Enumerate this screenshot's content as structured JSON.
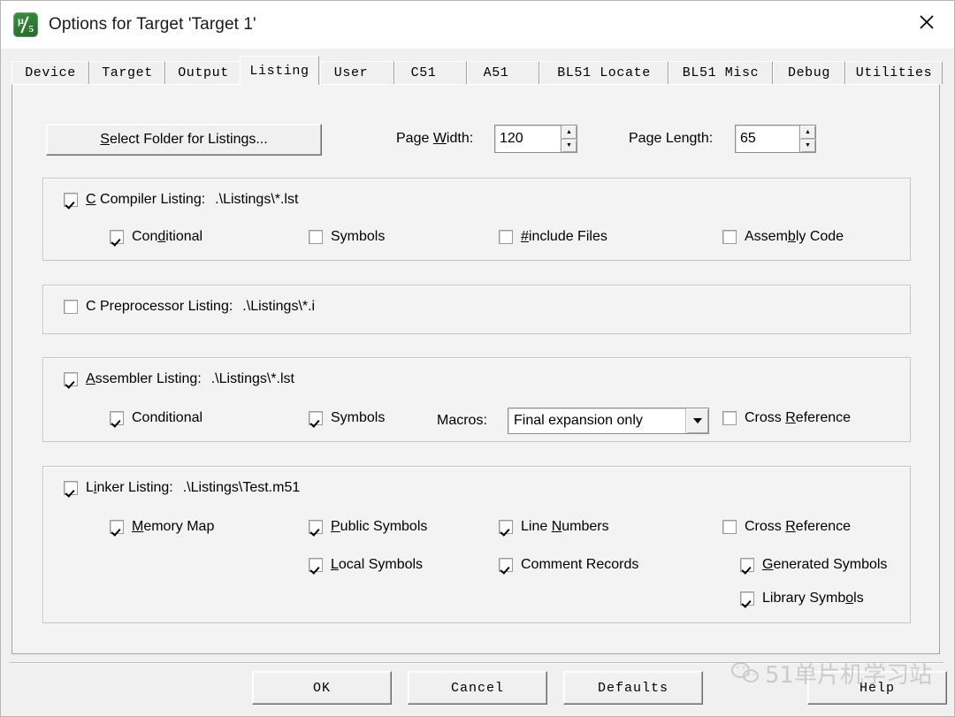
{
  "window": {
    "title": "Options for Target 'Target 1'",
    "app_icon": "keil-uvision5-icon",
    "close_label": "✕"
  },
  "tabs": [
    {
      "label": "Device",
      "selected": false
    },
    {
      "label": "Target",
      "selected": false
    },
    {
      "label": "Output",
      "selected": false
    },
    {
      "label": "Listing",
      "selected": true
    },
    {
      "label": "User",
      "selected": false
    },
    {
      "label": "C51",
      "selected": false
    },
    {
      "label": "A51",
      "selected": false
    },
    {
      "label": "BL51 Locate",
      "selected": false
    },
    {
      "label": "BL51 Misc",
      "selected": false
    },
    {
      "label": "Debug",
      "selected": false
    },
    {
      "label": "Utilities",
      "selected": false
    }
  ],
  "toolbar": {
    "select_folder_button": "Select Folder for Listings...",
    "page_width_label": "Page Width:",
    "page_width_value": "120",
    "page_length_label": "Page Length:",
    "page_length_value": "65",
    "spin_up": "▲",
    "spin_down": "▼"
  },
  "c_compiler_group": {
    "title": "C Compiler Listing:",
    "path": ".\\Listings\\*.lst",
    "enabled": true,
    "options": [
      {
        "label": "Conditional",
        "checked": true
      },
      {
        "label": "Symbols",
        "checked": false
      },
      {
        "label": "#include Files",
        "checked": false
      },
      {
        "label": "Assembly Code",
        "checked": false
      }
    ]
  },
  "c_preprocessor_group": {
    "title": "C Preprocessor Listing:",
    "path": ".\\Listings\\*.i",
    "enabled": false
  },
  "assembler_group": {
    "title": "Assembler Listing:",
    "path": ".\\Listings\\*.lst",
    "enabled": true,
    "options": [
      {
        "label": "Conditional",
        "checked": true
      },
      {
        "label": "Symbols",
        "checked": true
      }
    ],
    "macros_label": "Macros:",
    "macros_value": "Final expansion only",
    "cross_reference": {
      "label": "Cross Reference",
      "checked": false
    }
  },
  "linker_group": {
    "title": "Linker Listing:",
    "path": ".\\Listings\\Test.m51",
    "enabled": true,
    "options": [
      {
        "label": "Memory Map",
        "checked": true
      },
      {
        "label": "Public Symbols",
        "checked": true
      },
      {
        "label": "Line Numbers",
        "checked": true
      },
      {
        "label": "Cross Reference",
        "checked": false
      },
      {
        "label": "Local Symbols",
        "checked": true
      },
      {
        "label": "Comment Records",
        "checked": true
      },
      {
        "label": "Generated Symbols",
        "checked": true
      },
      {
        "label": "Library Symbols",
        "checked": true
      }
    ]
  },
  "footer": {
    "ok": "OK",
    "cancel": "Cancel",
    "defaults": "Defaults",
    "help": "Help"
  },
  "watermark": {
    "text": "51单片机学习站",
    "icon": "wechat-icon"
  },
  "colors": {
    "dialog_bg": "#f0f0f0",
    "panel_bg": "#f3f3f3",
    "titlebar_bg": "#ffffff",
    "border": "#c6c6c6",
    "text": "#000000",
    "brand_green": "#2f7a33"
  }
}
